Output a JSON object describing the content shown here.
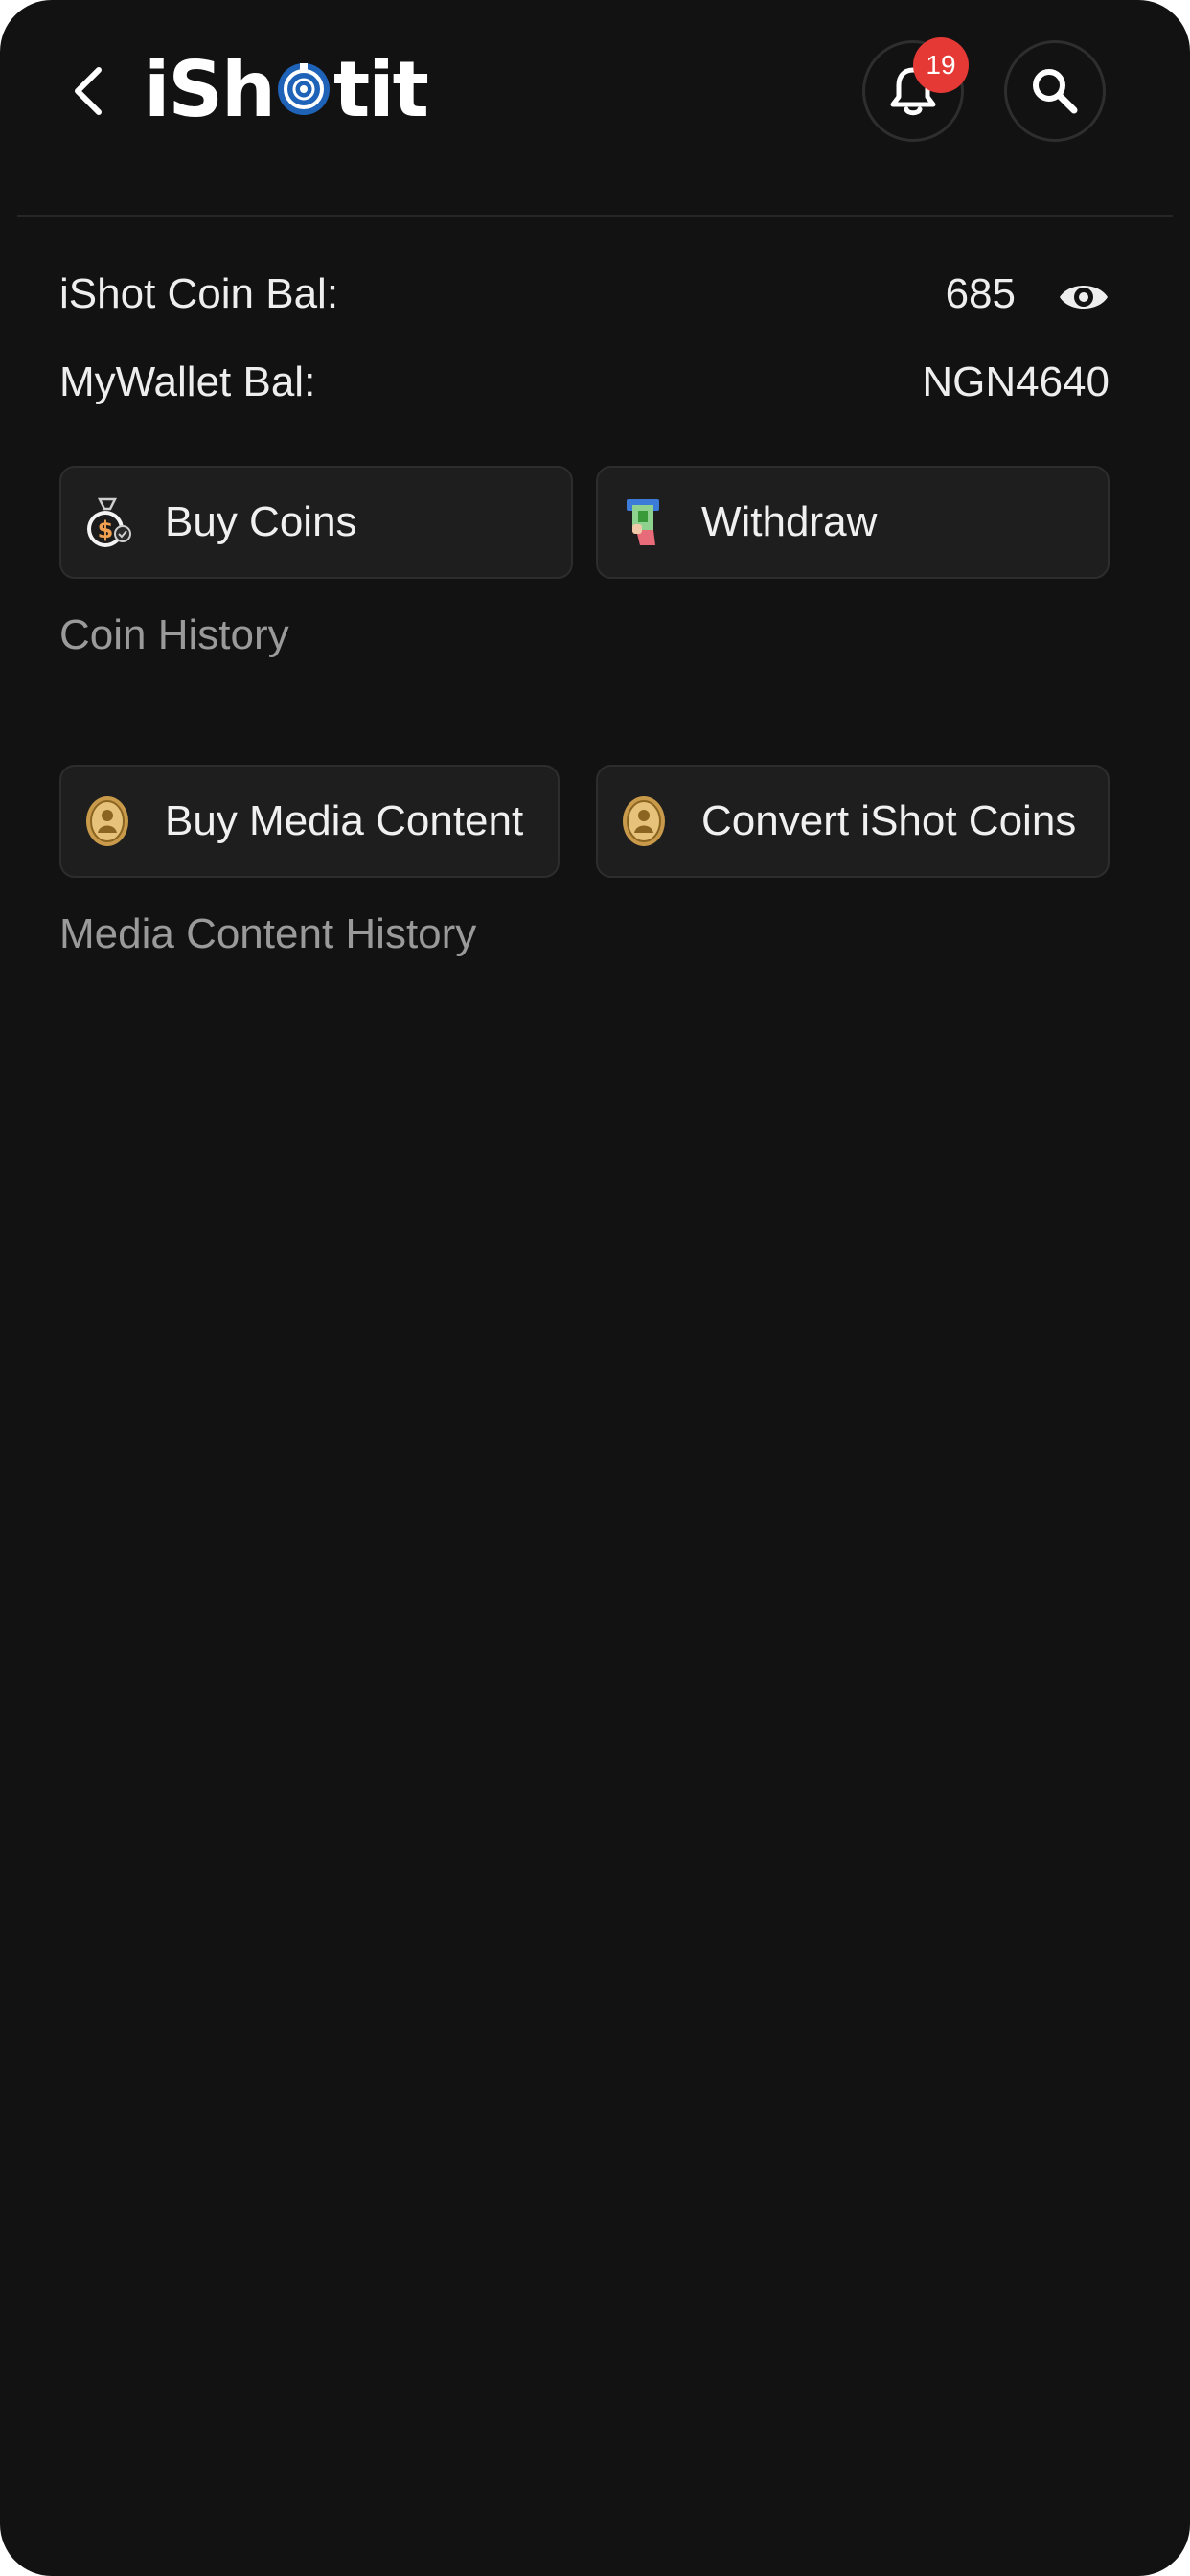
{
  "header": {
    "logo_text_left": "iSh",
    "logo_text_right": "tit",
    "notifications_count": "19"
  },
  "balances": {
    "coin_label": "iShot Coin Bal:",
    "coin_value": "685",
    "wallet_label": "MyWallet Bal:",
    "wallet_value": "NGN4640"
  },
  "actions": {
    "buy_coins": "Buy Coins",
    "withdraw": "Withdraw",
    "coin_history": "Coin History",
    "buy_media": "Buy Media Content",
    "convert_coins": "Convert iShot Coins",
    "media_history": "Media Content History"
  },
  "colors": {
    "background": "#121212",
    "button_bg": "#1e1e1e",
    "badge": "#e53935",
    "muted_text": "#9a9a9a"
  }
}
